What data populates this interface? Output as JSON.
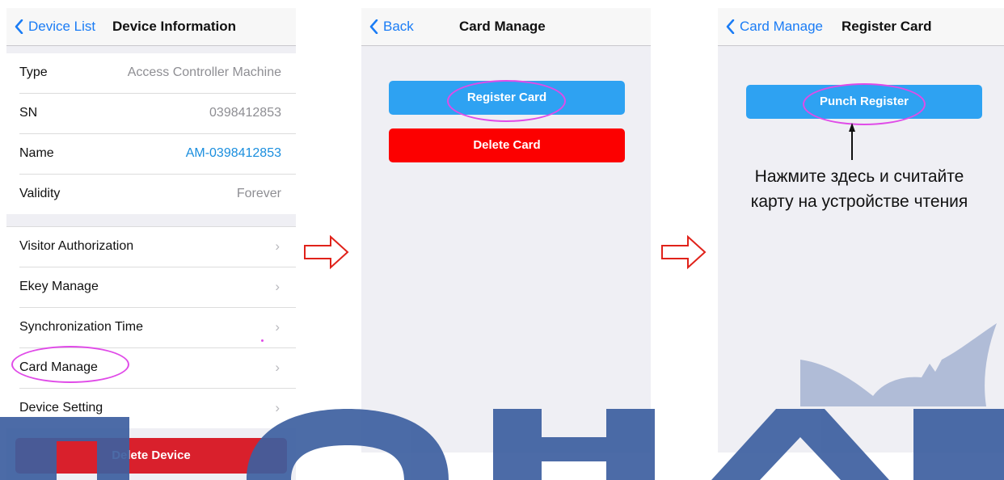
{
  "screen1": {
    "nav": {
      "back_label": "Device List",
      "title": "Device Information"
    },
    "info_rows": [
      {
        "label": "Type",
        "value": "Access Controller Machine"
      },
      {
        "label": "SN",
        "value": "0398412853"
      },
      {
        "label": "Name",
        "value": "AM-0398412853"
      },
      {
        "label": "Validity",
        "value": "Forever"
      }
    ],
    "menu_items": [
      {
        "label": "Visitor Authorization"
      },
      {
        "label": "Ekey Manage"
      },
      {
        "label": "Synchronization Time"
      },
      {
        "label": "Card Manage"
      },
      {
        "label": "Device Setting"
      }
    ],
    "delete_button": "Delete Device"
  },
  "screen2": {
    "nav": {
      "back_label": "Back",
      "title": "Card Manage"
    },
    "register_button": "Register Card",
    "delete_button": "Delete Card"
  },
  "screen3": {
    "nav": {
      "back_label": "Card Manage",
      "title": "Register Card"
    },
    "punch_button": "Punch Register",
    "instruction_line1": "Нажмите здесь и считайте",
    "instruction_line2": "карту на устройстве чтения"
  },
  "colors": {
    "ios_blue": "#1a7cf5",
    "button_blue": "#2ea2f2",
    "button_red": "#fc0000",
    "highlight_oval": "#e04be8",
    "arrow_red": "#e0221a",
    "watermark": "#3d5fa0"
  },
  "icons": {
    "back": "chevron-left-icon",
    "disclosure": "chevron-right-icon",
    "flow_arrow": "hollow-right-arrow-icon"
  }
}
